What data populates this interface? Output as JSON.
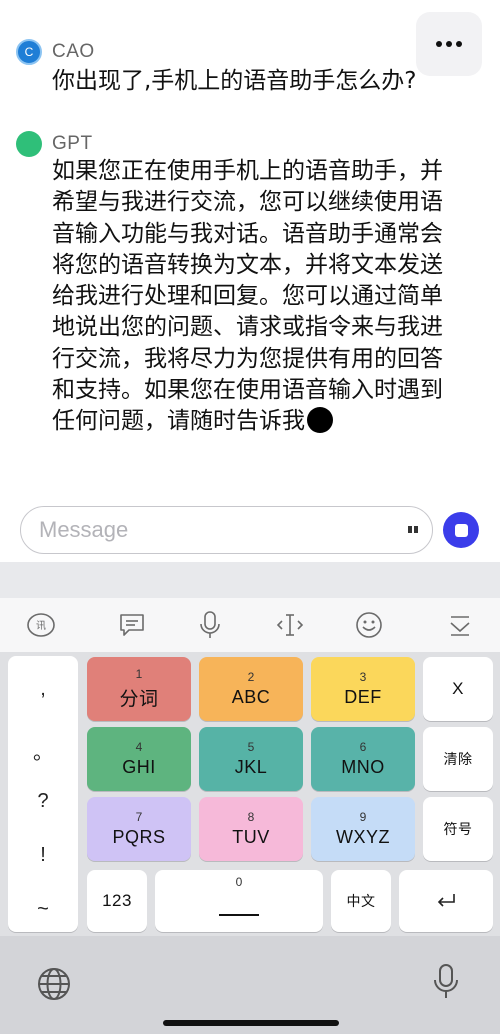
{
  "chat": {
    "more_icon": "ellipsis-icon",
    "messages": [
      {
        "avatar": "C",
        "sender": "CAO",
        "text": "你出现了,手机上的语音助手怎么办?"
      },
      {
        "avatar": "",
        "sender": "GPT",
        "text": "如果您正在使用手机上的语音助手，并希望与我进行交流，您可以继续使用语音输入功能与我对话。语音助手通常会将您的语音转换为文本，并将文本发送给我进行处理和回复。您可以通过简单地说出您的问题、请求或指令来与我进行交流，我将尽力为您提供有用的回答和支持。如果您在使用语音输入时遇到任何问题，请随时告诉我"
      }
    ]
  },
  "composer": {
    "placeholder": "Message",
    "send_state": "stop",
    "accent_color": "#3b3dea"
  },
  "keyboard": {
    "toolbar": [
      "ime-switch-icon",
      "clipboard-icon",
      "microphone-icon",
      "cursor-move-icon",
      "emoji-icon",
      "collapse-keyboard-icon"
    ],
    "punctuation": [
      ",",
      "。",
      "?",
      "!",
      "~"
    ],
    "keys": [
      {
        "num": "1",
        "label": "分词",
        "color": "#e08079"
      },
      {
        "num": "2",
        "label": "ABC",
        "color": "#f7b459"
      },
      {
        "num": "3",
        "label": "DEF",
        "color": "#fbd75b"
      },
      {
        "num": "4",
        "label": "GHI",
        "color": "#5eb47f"
      },
      {
        "num": "5",
        "label": "JKL",
        "color": "#56b3a6"
      },
      {
        "num": "6",
        "label": "MNO",
        "color": "#58b3a9"
      },
      {
        "num": "7",
        "label": "PQRS",
        "color": "#cfc3f5"
      },
      {
        "num": "8",
        "label": "TUV",
        "color": "#f6b9d9"
      },
      {
        "num": "9",
        "label": "WXYZ",
        "color": "#c5dcf7"
      }
    ],
    "delete_label": "X",
    "clear_label": "清除",
    "symbols_label": "符号",
    "numbers_label": "123",
    "space_num": "0",
    "lang_label": "中文",
    "return_icon": "return-icon",
    "globe_icon": "globe-icon",
    "dictation_icon": "microphone-icon"
  }
}
